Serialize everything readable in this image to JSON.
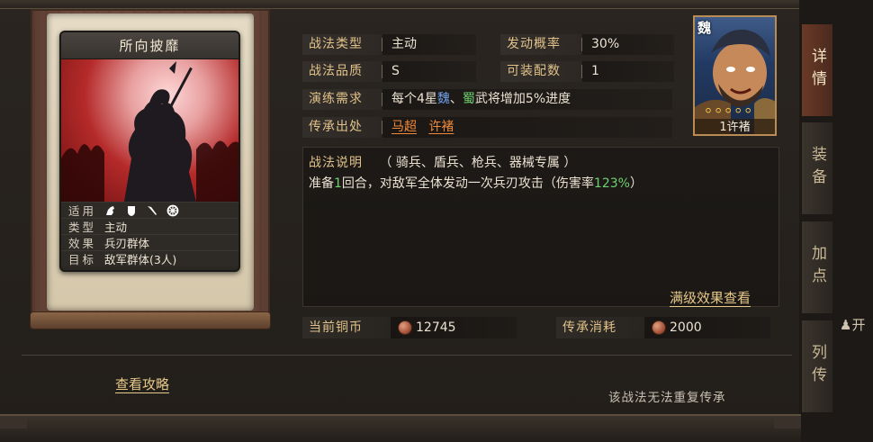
{
  "card": {
    "title": "所向披靡",
    "rows": [
      {
        "key": "适用",
        "value": ""
      },
      {
        "key": "类型",
        "value": "主动"
      },
      {
        "key": "效果",
        "value": "兵刃群体"
      },
      {
        "key": "目标",
        "value": "敌军群体(3人)"
      }
    ],
    "unit_icons": [
      "cavalry-icon",
      "shield-icon",
      "spear-icon",
      "siege-wheel-icon"
    ]
  },
  "info": {
    "type_label": "战法类型",
    "type_value": "主动",
    "prob_label": "发动概率",
    "prob_value": "30%",
    "quality_label": "战法品质",
    "quality_value": "S",
    "slots_label": "可装配数",
    "slots_value": "1",
    "train_label": "演练需求",
    "train_prefix": "每个4星",
    "train_wei": "魏",
    "train_mid": "、",
    "train_shu": "蜀",
    "train_suffix": "武将增加5%进度",
    "origin_label": "传承出处",
    "origin_1": "马超",
    "origin_2": "许褚"
  },
  "desc": {
    "label": "战法说明",
    "troops": "（  骑兵、盾兵、枪兵、器械专属 ）",
    "line_prefix": "准备",
    "line_num": "1",
    "line_mid": "回合，对敌军全体发动一次兵刃攻击（伤害率",
    "line_rate": "123%",
    "line_suffix": "）",
    "maxlevel_link": "满级效果查看"
  },
  "coins": {
    "current_label": "当前铜币",
    "current_value": "12745",
    "cost_label": "传承消耗",
    "cost_value": "2000"
  },
  "footer": {
    "strategy_link": "查看攻略",
    "note": "该战法无法重复传承"
  },
  "portrait": {
    "faction": "魏",
    "stars": 5,
    "name": "1许褚"
  },
  "tabs": [
    "详情",
    "装备",
    "加点",
    "列传"
  ],
  "side_text": "开"
}
